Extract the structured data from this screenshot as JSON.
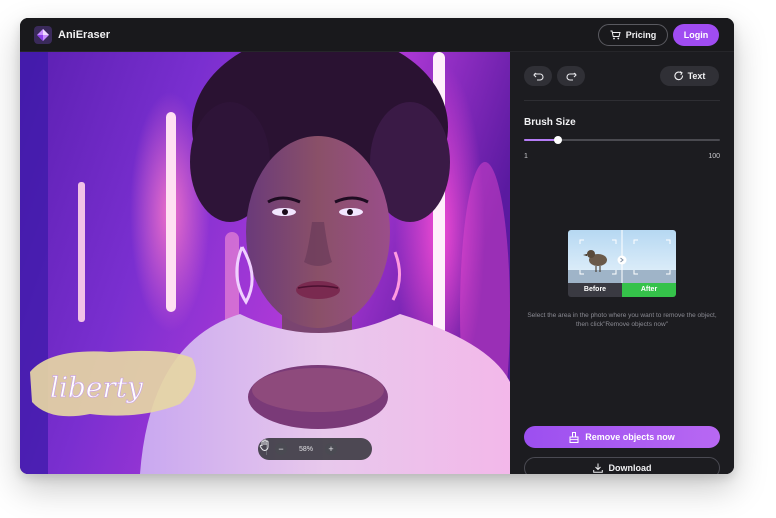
{
  "app": {
    "name": "AniEraser"
  },
  "topbar": {
    "pricing_label": "Pricing",
    "login_label": "Login"
  },
  "canvas": {
    "watermark_text": "liberty",
    "zoom": {
      "percent": "58%",
      "minus": "−",
      "plus": "+"
    }
  },
  "panel": {
    "text_button_label": "Text",
    "brush": {
      "title": "Brush Size",
      "min": "1",
      "max": "100",
      "value": 18
    },
    "preview": {
      "before_label": "Before",
      "after_label": "After"
    },
    "instruction": "Select the area in the photo where you want to remove the object, then click\"Remove objects now\"",
    "remove_label": "Remove objects now",
    "download_label": "Download"
  },
  "colors": {
    "accent": "#a04cf2",
    "after_badge": "#35c24a",
    "panel_bg": "#1c1c20"
  },
  "icons": [
    "app-logo-icon",
    "cart-icon",
    "undo-icon",
    "redo-icon",
    "refresh-icon",
    "hand-icon",
    "remove-object-icon",
    "download-icon"
  ]
}
